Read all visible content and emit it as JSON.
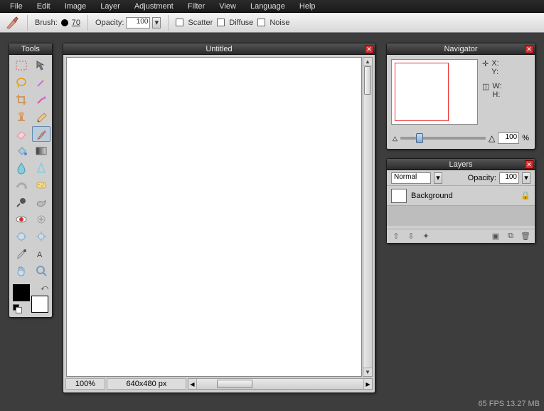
{
  "menu": {
    "items": [
      "File",
      "Edit",
      "Image",
      "Layer",
      "Adjustment",
      "Filter",
      "View",
      "Language",
      "Help"
    ]
  },
  "options": {
    "brush_label": "Brush:",
    "brush_size": "70",
    "opacity_label": "Opacity:",
    "opacity_value": "100",
    "scatter_label": "Scatter",
    "diffuse_label": "Diffuse",
    "noise_label": "Noise"
  },
  "tools_panel": {
    "title": "Tools"
  },
  "document": {
    "title": "Untitled",
    "zoom": "100%",
    "dimensions": "640x480 px"
  },
  "navigator": {
    "title": "Navigator",
    "x_label": "X:",
    "y_label": "Y:",
    "w_label": "W:",
    "h_label": "H:",
    "zoom_value": "100",
    "zoom_percent": "%"
  },
  "layers_panel": {
    "title": "Layers",
    "blend_mode": "Normal",
    "opacity_label": "Opacity:",
    "opacity_value": "100",
    "layers": [
      {
        "name": "Background"
      }
    ]
  },
  "swatches": {
    "fg": "#000000",
    "bg": "#ffffff"
  },
  "status": {
    "fps": "65 FPS",
    "mem": "13.27 MB"
  }
}
